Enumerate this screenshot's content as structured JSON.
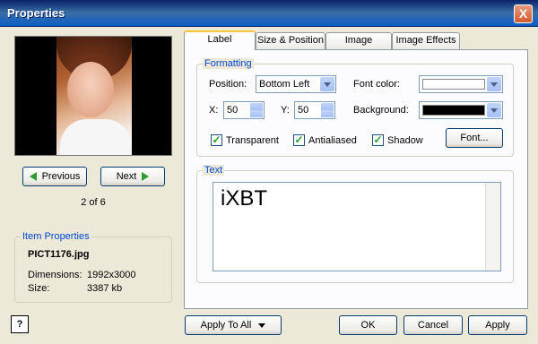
{
  "window": {
    "title": "Properties",
    "close_glyph": "X"
  },
  "preview": {
    "counter": "2 of 6"
  },
  "nav": {
    "previous": "Previous",
    "next": "Next"
  },
  "item_properties": {
    "legend": "Item Properties",
    "filename": "PICT1176.jpg",
    "dimensions_label": "Dimensions:",
    "dimensions_value": "1992x3000",
    "size_label": "Size:",
    "size_value": "3387 kb"
  },
  "tabs": [
    {
      "label": "Label",
      "active": true
    },
    {
      "label": "Size & Position",
      "active": false
    },
    {
      "label": "Image",
      "active": false
    },
    {
      "label": "Image Effects",
      "active": false
    }
  ],
  "formatting": {
    "legend": "Formatting",
    "position_label": "Position:",
    "position_value": "Bottom Left",
    "font_color_label": "Font color:",
    "x_label": "X:",
    "x_value": "50",
    "y_label": "Y:",
    "y_value": "50",
    "background_label": "Background:",
    "transparent_label": "Transparent",
    "antialiased_label": "Antialiased",
    "shadow_label": "Shadow",
    "font_button": "Font...",
    "font_color": "#FFFFFF",
    "background_color": "#000000"
  },
  "text_group": {
    "legend": "Text",
    "value": "iXBT"
  },
  "footer": {
    "apply_to_all": "Apply To All",
    "ok": "OK",
    "cancel": "Cancel",
    "apply": "Apply",
    "help_glyph": "?"
  }
}
